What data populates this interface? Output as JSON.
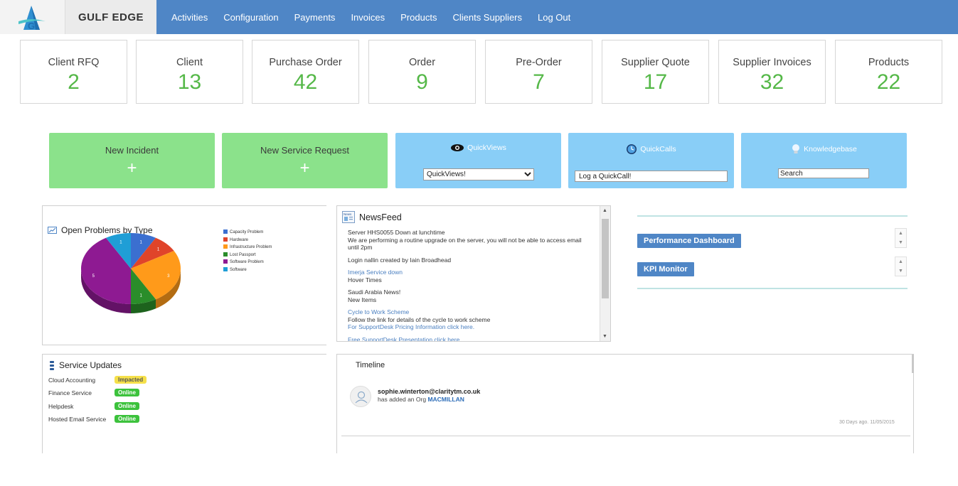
{
  "brand": "GULF EDGE",
  "nav": [
    "Activities",
    "Configuration",
    "Payments",
    "Invoices",
    "Products",
    "Clients Suppliers",
    "Log Out"
  ],
  "stats": [
    {
      "label": "Client RFQ",
      "value": "2"
    },
    {
      "label": "Client",
      "value": "13"
    },
    {
      "label": "Purchase Order",
      "value": "42"
    },
    {
      "label": "Order",
      "value": "9"
    },
    {
      "label": "Pre-Order",
      "value": "7"
    },
    {
      "label": "Supplier Quote",
      "value": "17"
    },
    {
      "label": "Supplier Invoices",
      "value": "32"
    },
    {
      "label": "Products",
      "value": "22"
    }
  ],
  "tiles": {
    "new_incident": "New Incident",
    "new_service_request": "New Service Request",
    "plus": "+",
    "quickviews": {
      "title": "QuickViews",
      "selected": "QuickViews!"
    },
    "quickcalls": {
      "title": "QuickCalls",
      "value": "Log a QuickCall!"
    },
    "knowledgebase": {
      "title": "Knowledgebase",
      "value": "Search"
    }
  },
  "colors": {
    "nav": "#4f86c6",
    "stat_value": "#55b848",
    "tile_green": "#8be28b",
    "tile_blue": "#89cef7"
  },
  "problems": {
    "title": "Open Problems by Type",
    "chart_data": {
      "type": "pie",
      "categories": [
        "Capacity Problem",
        "Hardware",
        "Infrastructure Problem",
        "Lost Passport",
        "Software Problem",
        "Software"
      ],
      "values": [
        1,
        1,
        3,
        1,
        5,
        1
      ],
      "colors": [
        "#3b6fd0",
        "#e0442a",
        "#ff9a1a",
        "#2a8d2a",
        "#8e1a92",
        "#1f9ed6"
      ]
    }
  },
  "newsfeed": {
    "title": "NewsFeed",
    "items": [
      {
        "text": "Server HHS0055 Down at lunchtime",
        "link": false
      },
      {
        "text": "We are performing a routine upgrade on the server, you will not be able to access email until 2pm",
        "link": false
      },
      {
        "text": "",
        "link": false
      },
      {
        "text": "Login nallin created by Iain Broadhead",
        "link": false
      },
      {
        "text": "",
        "link": false
      },
      {
        "text": "Imerja Service down",
        "link": true
      },
      {
        "text": "Hover Times",
        "link": false
      },
      {
        "text": "",
        "link": false
      },
      {
        "text": "Saudi Arabia News!",
        "link": false
      },
      {
        "text": "New Items",
        "link": false
      },
      {
        "text": "",
        "link": false
      },
      {
        "text": "Cycle to Work Scheme",
        "link": true
      },
      {
        "text": "Follow the link for details of the cycle to work scheme",
        "link": false
      },
      {
        "text": "For SupportDesk Pricing Information click here.",
        "link": true
      },
      {
        "text": "",
        "link": false
      },
      {
        "text": "Free SupportDesk Presentation click here",
        "link": true
      }
    ]
  },
  "dashboards": [
    "Performance Dashboard",
    "KPI Monitor"
  ],
  "service_updates": {
    "title": "Service Updates",
    "rows": [
      {
        "name": "Cloud Accounting",
        "status": "Impacted",
        "color": "#f5e04a"
      },
      {
        "name": "Finance Service",
        "status": "Online",
        "color": "#3cc23c"
      },
      {
        "name": "Helpdesk",
        "status": "Online",
        "color": "#3cc23c"
      },
      {
        "name": "Hosted Email Service",
        "status": "Online",
        "color": "#3cc23c"
      }
    ]
  },
  "timeline": {
    "title": "Timeline",
    "user": "sophie.winterton@claritytm.co.uk",
    "action": "has added an Org",
    "org": "MACMILLAN",
    "time": "30 Days ago. 11/05/2015"
  }
}
